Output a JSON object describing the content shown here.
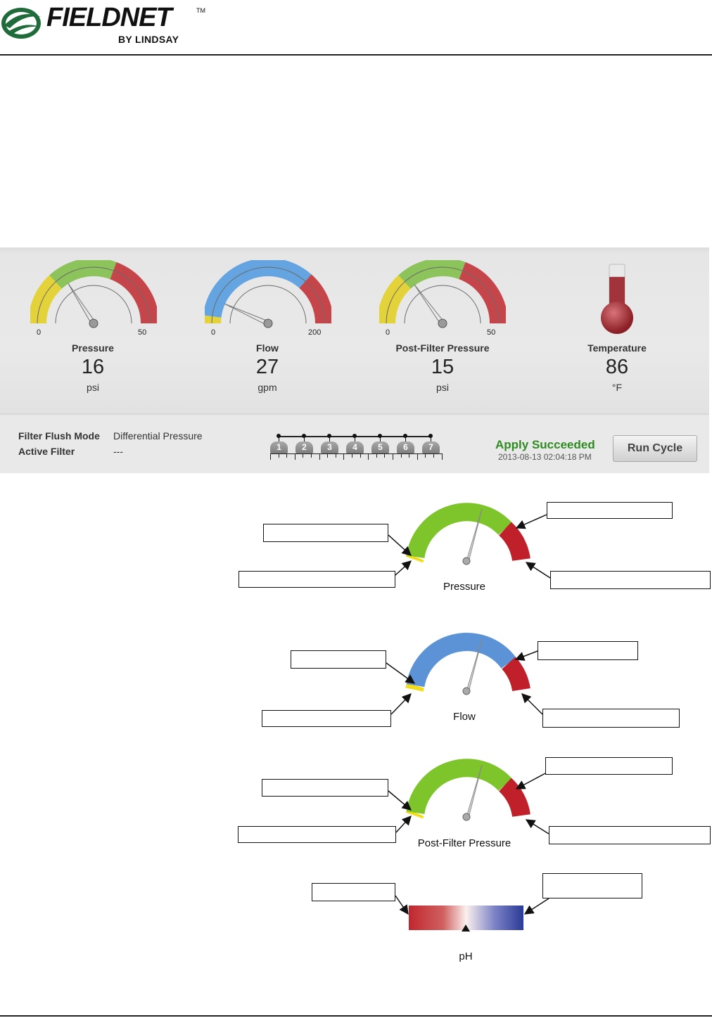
{
  "header": {
    "brand": "FIELDNET",
    "trademark": "TM",
    "byline": "BY LINDSAY"
  },
  "gauges": [
    {
      "label": "Pressure",
      "value": "16",
      "unit": "psi",
      "min": "0",
      "max": "50",
      "fraction": 0.32
    },
    {
      "label": "Flow",
      "value": "27",
      "unit": "gpm",
      "min": "0",
      "max": "200",
      "fraction": 0.135
    },
    {
      "label": "Post-Filter Pressure",
      "value": "15",
      "unit": "psi",
      "min": "0",
      "max": "50",
      "fraction": 0.3
    },
    {
      "label": "Temperature",
      "value": "86",
      "unit": "°F",
      "fill_fraction": 0.78
    }
  ],
  "status": {
    "filter_flush_mode_label": "Filter Flush Mode",
    "filter_flush_mode_value": "Differential Pressure",
    "active_filter_label": "Active Filter",
    "active_filter_value": "---",
    "filters": [
      "1",
      "2",
      "3",
      "4",
      "5",
      "6",
      "7"
    ],
    "apply_status": "Apply Succeeded",
    "apply_time": "2013-08-13 02:04:18 PM",
    "run_button": "Run Cycle"
  },
  "diagrams": {
    "pressure_title": "Pressure",
    "flow_title": "Flow",
    "post_filter_title": "Post-Filter Pressure",
    "ph_title": "pH"
  },
  "colors": {
    "green": "#7dc52a",
    "yellow": "#f1dc1a",
    "red": "#c0202a",
    "blue": "#5b93d6",
    "ph_red": "#c0282e",
    "ph_blue": "#2a3a96",
    "apply_green": "#2e8b20"
  }
}
